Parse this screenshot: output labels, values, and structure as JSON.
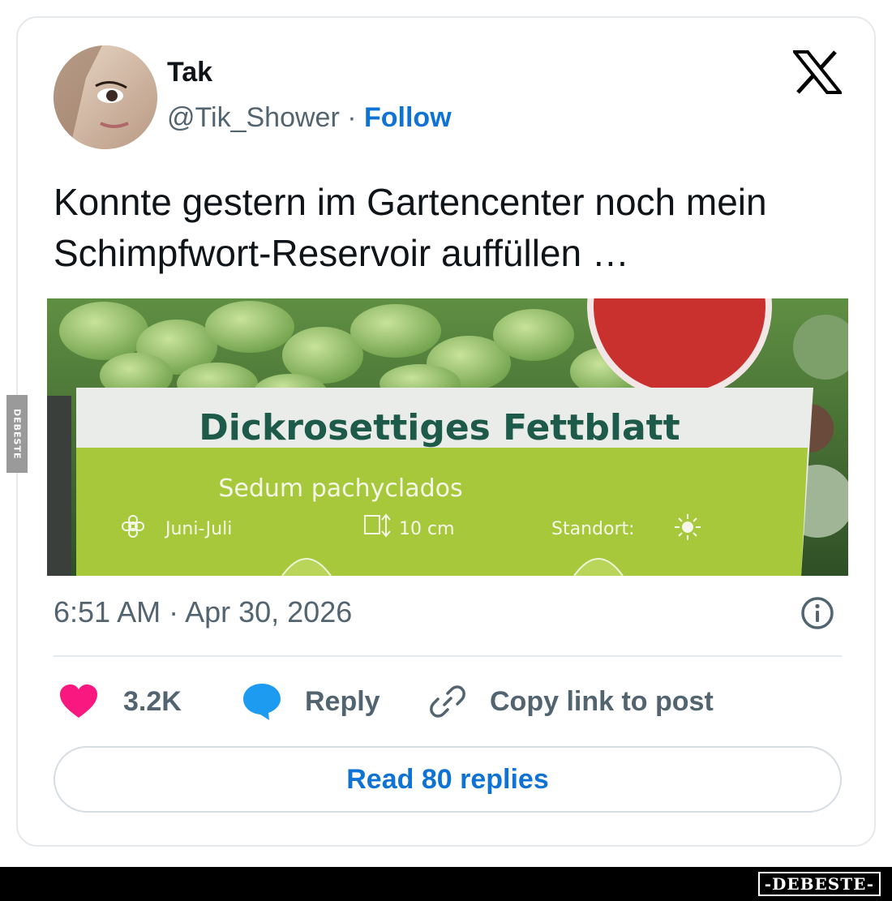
{
  "tweet": {
    "author": {
      "name": "Tak",
      "handle": "@Tik_Shower",
      "separator": "·",
      "follow_label": "Follow"
    },
    "text": "Konnte gestern im Gartencenter noch mein Schimpfwort-Reservoir auffüllen …",
    "media": {
      "label_title": "Dickrosettiges Fettblatt",
      "label_latin": "Sedum pachyclados",
      "bloom": "Juni-Juli",
      "height": "10 cm",
      "location": "Standort:"
    },
    "timestamp": "6:51 AM · Apr 30, 2026",
    "actions": {
      "like_count": "3.2K",
      "reply_label": "Reply",
      "copy_label": "Copy link to post"
    },
    "read_replies_label": "Read 80 replies"
  },
  "icons": {
    "brand": "x-logo-icon",
    "info": "info-icon",
    "like": "heart-icon",
    "reply": "speech-bubble-icon",
    "copy": "link-icon"
  },
  "colors": {
    "link_blue": "#0f73d6",
    "heart": "#f91880",
    "reply_bubble": "#1d9bf0",
    "muted_text": "#536471",
    "border": "#e6e9ec"
  },
  "watermark": {
    "side": "DEBESTE",
    "bottom": "-DEBESTE-"
  }
}
